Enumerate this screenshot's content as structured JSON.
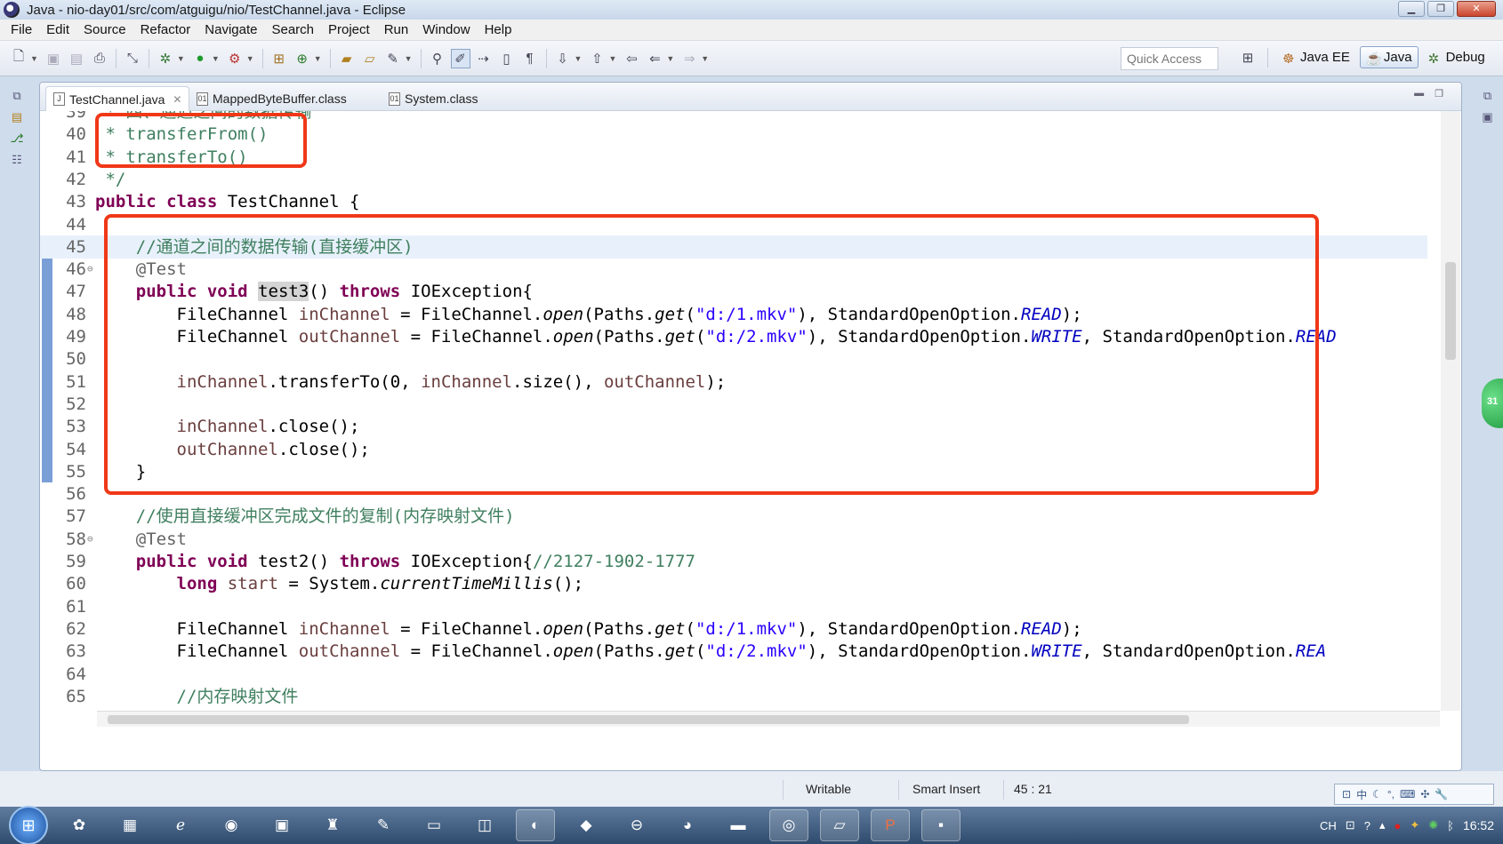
{
  "window": {
    "title": "Java - nio-day01/src/com/atguigu/nio/TestChannel.java - Eclipse"
  },
  "menu": [
    "File",
    "Edit",
    "Source",
    "Refactor",
    "Navigate",
    "Search",
    "Project",
    "Run",
    "Window",
    "Help"
  ],
  "toolbar": {
    "quick_access_placeholder": "Quick Access",
    "perspectives": [
      {
        "label": "Java EE",
        "active": false
      },
      {
        "label": "Java",
        "active": true
      },
      {
        "label": "Debug",
        "active": false
      }
    ]
  },
  "tabs": [
    {
      "label": "TestChannel.java",
      "active": true
    },
    {
      "label": "MappedByteBuffer.class",
      "active": false
    },
    {
      "label": "System.class",
      "active": false
    }
  ],
  "editor": {
    "lines": [
      {
        "n": "39",
        "tokens": [
          {
            "t": " * 四、通道之间的数据传输",
            "c": "cm"
          }
        ]
      },
      {
        "n": "40",
        "tokens": [
          {
            "t": " * transferFrom()",
            "c": "cm"
          }
        ]
      },
      {
        "n": "41",
        "tokens": [
          {
            "t": " * transferTo()",
            "c": "cm"
          }
        ]
      },
      {
        "n": "42",
        "tokens": [
          {
            "t": " */",
            "c": "cm"
          }
        ]
      },
      {
        "n": "43",
        "tokens": [
          {
            "t": "public",
            "c": "kw"
          },
          {
            "t": " "
          },
          {
            "t": "class",
            "c": "kw"
          },
          {
            "t": " TestChannel {"
          }
        ]
      },
      {
        "n": "44",
        "tokens": []
      },
      {
        "n": "45",
        "current": true,
        "tokens": [
          {
            "t": "    //通道之间的数据传输(直接缓冲区)",
            "c": "cm"
          }
        ]
      },
      {
        "n": "46",
        "fold": true,
        "tokens": [
          {
            "t": "    @Test",
            "c": "ann"
          }
        ]
      },
      {
        "n": "47",
        "tokens": [
          {
            "t": "    "
          },
          {
            "t": "public",
            "c": "kw"
          },
          {
            "t": " "
          },
          {
            "t": "void",
            "c": "kw"
          },
          {
            "t": " "
          },
          {
            "t": "test3",
            "c": "hl"
          },
          {
            "t": "() "
          },
          {
            "t": "throws",
            "c": "kw"
          },
          {
            "t": " IOException{"
          }
        ]
      },
      {
        "n": "48",
        "tokens": [
          {
            "t": "        FileChannel "
          },
          {
            "t": "inChannel",
            "c": "var"
          },
          {
            "t": " = FileChannel."
          },
          {
            "t": "open",
            "c": "st"
          },
          {
            "t": "(Paths."
          },
          {
            "t": "get",
            "c": "st"
          },
          {
            "t": "("
          },
          {
            "t": "\"d:/1.mkv\"",
            "c": "str"
          },
          {
            "t": "), StandardOpenOption."
          },
          {
            "t": "READ",
            "c": "stc"
          },
          {
            "t": ");"
          }
        ]
      },
      {
        "n": "49",
        "tokens": [
          {
            "t": "        FileChannel "
          },
          {
            "t": "outChannel",
            "c": "var"
          },
          {
            "t": " = FileChannel."
          },
          {
            "t": "open",
            "c": "st"
          },
          {
            "t": "(Paths."
          },
          {
            "t": "get",
            "c": "st"
          },
          {
            "t": "("
          },
          {
            "t": "\"d:/2.mkv\"",
            "c": "str"
          },
          {
            "t": "), StandardOpenOption."
          },
          {
            "t": "WRITE",
            "c": "stc"
          },
          {
            "t": ", StandardOpenOption."
          },
          {
            "t": "READ",
            "c": "stc"
          }
        ]
      },
      {
        "n": "50",
        "tokens": []
      },
      {
        "n": "51",
        "tokens": [
          {
            "t": "        "
          },
          {
            "t": "inChannel",
            "c": "var"
          },
          {
            "t": ".transferTo(0, "
          },
          {
            "t": "inChannel",
            "c": "var"
          },
          {
            "t": ".size(), "
          },
          {
            "t": "outChannel",
            "c": "var"
          },
          {
            "t": ");"
          }
        ]
      },
      {
        "n": "52",
        "tokens": []
      },
      {
        "n": "53",
        "tokens": [
          {
            "t": "        "
          },
          {
            "t": "inChannel",
            "c": "var"
          },
          {
            "t": ".close();"
          }
        ]
      },
      {
        "n": "54",
        "tokens": [
          {
            "t": "        "
          },
          {
            "t": "outChannel",
            "c": "var"
          },
          {
            "t": ".close();"
          }
        ]
      },
      {
        "n": "55",
        "tokens": [
          {
            "t": "    }"
          }
        ]
      },
      {
        "n": "56",
        "tokens": []
      },
      {
        "n": "57",
        "tokens": [
          {
            "t": "    //使用直接缓冲区完成文件的复制(内存映射文件)",
            "c": "cm"
          }
        ]
      },
      {
        "n": "58",
        "fold": true,
        "tokens": [
          {
            "t": "    @Test",
            "c": "ann"
          }
        ]
      },
      {
        "n": "59",
        "tokens": [
          {
            "t": "    "
          },
          {
            "t": "public",
            "c": "kw"
          },
          {
            "t": " "
          },
          {
            "t": "void",
            "c": "kw"
          },
          {
            "t": " test2() "
          },
          {
            "t": "throws",
            "c": "kw"
          },
          {
            "t": " IOException{"
          },
          {
            "t": "//2127-1902-1777",
            "c": "cm"
          }
        ]
      },
      {
        "n": "60",
        "tokens": [
          {
            "t": "        "
          },
          {
            "t": "long",
            "c": "kw"
          },
          {
            "t": " "
          },
          {
            "t": "start",
            "c": "var"
          },
          {
            "t": " = System."
          },
          {
            "t": "currentTimeMillis",
            "c": "st"
          },
          {
            "t": "();"
          }
        ]
      },
      {
        "n": "61",
        "tokens": []
      },
      {
        "n": "62",
        "tokens": [
          {
            "t": "        FileChannel "
          },
          {
            "t": "inChannel",
            "c": "var"
          },
          {
            "t": " = FileChannel."
          },
          {
            "t": "open",
            "c": "st"
          },
          {
            "t": "(Paths."
          },
          {
            "t": "get",
            "c": "st"
          },
          {
            "t": "("
          },
          {
            "t": "\"d:/1.mkv\"",
            "c": "str"
          },
          {
            "t": "), StandardOpenOption."
          },
          {
            "t": "READ",
            "c": "stc"
          },
          {
            "t": ");"
          }
        ]
      },
      {
        "n": "63",
        "tokens": [
          {
            "t": "        FileChannel "
          },
          {
            "t": "outChannel",
            "c": "var"
          },
          {
            "t": " = FileChannel."
          },
          {
            "t": "open",
            "c": "st"
          },
          {
            "t": "(Paths."
          },
          {
            "t": "get",
            "c": "st"
          },
          {
            "t": "("
          },
          {
            "t": "\"d:/2.mkv\"",
            "c": "str"
          },
          {
            "t": "), StandardOpenOption."
          },
          {
            "t": "WRITE",
            "c": "stc"
          },
          {
            "t": ", StandardOpenOption."
          },
          {
            "t": "REA",
            "c": "stc"
          }
        ]
      },
      {
        "n": "64",
        "tokens": []
      },
      {
        "n": "65",
        "tokens": [
          {
            "t": "        //内存映射文件",
            "c": "cm"
          }
        ]
      }
    ]
  },
  "status": {
    "writable": "Writable",
    "insert_mode": "Smart Insert",
    "position": "45 : 21"
  },
  "ime": {
    "lang": "中"
  },
  "taskbar": {
    "clock": "16:52",
    "tray_lang": "CH",
    "badge": "31"
  },
  "colors": {
    "highlight_box": "#f03818",
    "keyword": "#7f0055",
    "comment": "#3f7f5f",
    "string": "#2a00ff",
    "field": "#0000c0",
    "variable": "#6a3e3e"
  }
}
